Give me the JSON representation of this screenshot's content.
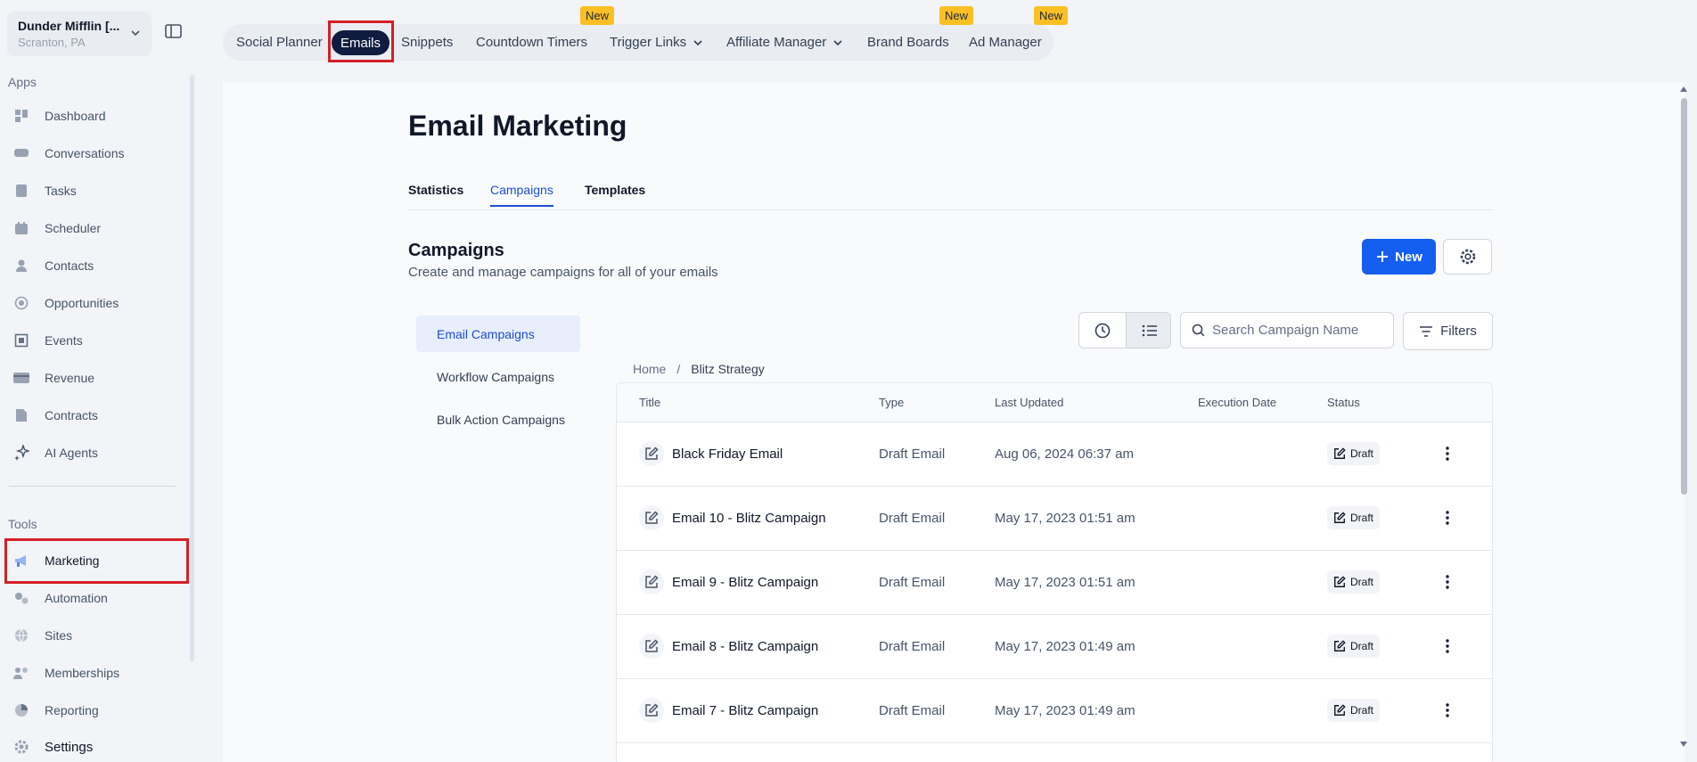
{
  "location": {
    "name": "Dunder Mifflin [...",
    "address": "Scranton, PA"
  },
  "sidebar": {
    "apps_label": "Apps",
    "apps": [
      {
        "label": "Dashboard",
        "icon": "dashboard-icon"
      },
      {
        "label": "Conversations",
        "icon": "chat-icon"
      },
      {
        "label": "Tasks",
        "icon": "tasks-icon"
      },
      {
        "label": "Scheduler",
        "icon": "calendar-icon"
      },
      {
        "label": "Contacts",
        "icon": "person-icon"
      },
      {
        "label": "Opportunities",
        "icon": "target-icon"
      },
      {
        "label": "Events",
        "icon": "events-icon"
      },
      {
        "label": "Revenue",
        "icon": "card-icon"
      },
      {
        "label": "Contracts",
        "icon": "document-icon"
      },
      {
        "label": "AI Agents",
        "icon": "sparkle-icon"
      }
    ],
    "tools_label": "Tools",
    "tools": [
      {
        "label": "Marketing",
        "icon": "megaphone-icon"
      },
      {
        "label": "Automation",
        "icon": "gears-icon"
      },
      {
        "label": "Sites",
        "icon": "globe-icon"
      },
      {
        "label": "Memberships",
        "icon": "members-icon"
      },
      {
        "label": "Reporting",
        "icon": "pie-icon"
      }
    ],
    "settings_label": "Settings"
  },
  "topnav": {
    "items": [
      {
        "label": "Social Planner"
      },
      {
        "label": "Emails"
      },
      {
        "label": "Snippets"
      },
      {
        "label": "Countdown Timers",
        "badge": "New"
      },
      {
        "label": "Trigger Links"
      },
      {
        "label": "Affiliate Manager"
      },
      {
        "label": "Brand Boards",
        "badge": "New"
      },
      {
        "label": "Ad Manager",
        "badge": "New"
      }
    ]
  },
  "page": {
    "title": "Email Marketing",
    "tabs": [
      "Statistics",
      "Campaigns",
      "Templates"
    ],
    "section_title": "Campaigns",
    "section_desc": "Create and manage campaigns for all of your emails",
    "new_button": "New",
    "filters_button": "Filters",
    "search_placeholder": "Search Campaign Name",
    "side_menu": [
      "Email Campaigns",
      "Workflow Campaigns",
      "Bulk Action Campaigns"
    ],
    "breadcrumb": {
      "home": "Home",
      "sep": "/",
      "current": "Blitz Strategy"
    }
  },
  "table": {
    "headers": [
      "Title",
      "Type",
      "Last Updated",
      "Execution Date",
      "Status"
    ],
    "rows": [
      {
        "title": "Black Friday Email",
        "type": "Draft Email",
        "updated": "Aug 06, 2024 06:37 am",
        "execution": "",
        "status": "Draft"
      },
      {
        "title": "Email 10 - Blitz Campaign",
        "type": "Draft Email",
        "updated": "May 17, 2023 01:51 am",
        "execution": "",
        "status": "Draft"
      },
      {
        "title": "Email 9 - Blitz Campaign",
        "type": "Draft Email",
        "updated": "May 17, 2023 01:51 am",
        "execution": "",
        "status": "Draft"
      },
      {
        "title": "Email 8 - Blitz Campaign",
        "type": "Draft Email",
        "updated": "May 17, 2023 01:49 am",
        "execution": "",
        "status": "Draft"
      },
      {
        "title": "Email 7 - Blitz Campaign",
        "type": "Draft Email",
        "updated": "May 17, 2023 01:49 am",
        "execution": "",
        "status": "Draft"
      }
    ]
  },
  "colors": {
    "primary": "#155eef",
    "active_nav": "#0f1c3f",
    "highlight": "#d42029",
    "badge": "#fbbf24"
  }
}
